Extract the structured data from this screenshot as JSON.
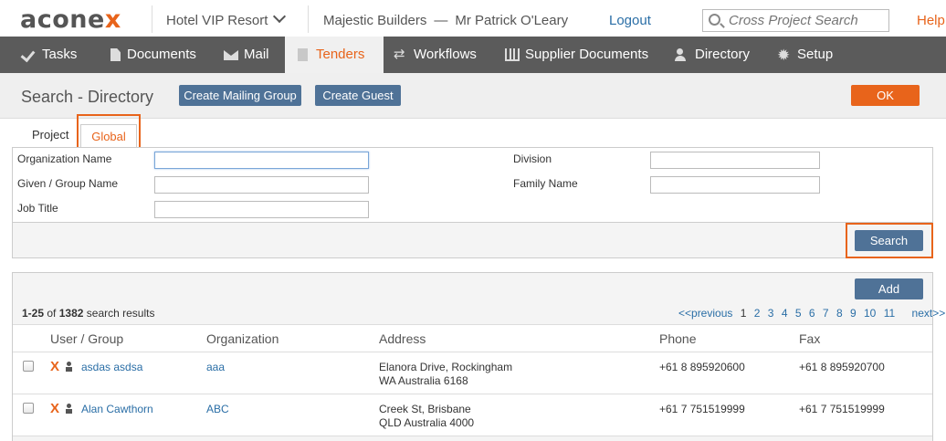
{
  "header": {
    "logo_prefix": "acone",
    "logo_suffix": "x",
    "project": "Hotel VIP Resort",
    "organization": "Majestic Builders",
    "separator": "—",
    "user": "Mr Patrick O'Leary",
    "logout": "Logout",
    "search_placeholder": "Cross Project Search",
    "help": "Help"
  },
  "nav": {
    "items": [
      {
        "label": "Tasks",
        "icon": "check-icon"
      },
      {
        "label": "Documents",
        "icon": "document-icon"
      },
      {
        "label": "Mail",
        "icon": "mail-icon"
      },
      {
        "label": "Tenders",
        "icon": "tender-icon",
        "active": true
      },
      {
        "label": "Workflows",
        "icon": "workflow-icon"
      },
      {
        "label": "Supplier Documents",
        "icon": "supplier-icon"
      },
      {
        "label": "Directory",
        "icon": "people-icon"
      },
      {
        "label": "Setup",
        "icon": "gear-icon"
      }
    ]
  },
  "page": {
    "title": "Search - Directory",
    "create_mailing_group": "Create Mailing Group",
    "create_guest": "Create Guest",
    "ok": "OK"
  },
  "tabs": {
    "project": "Project",
    "global": "Global"
  },
  "form": {
    "org_name_label": "Organization Name",
    "given_name_label": "Given / Group Name",
    "job_title_label": "Job Title",
    "division_label": "Division",
    "family_name_label": "Family Name",
    "org_name_value": "",
    "given_name_value": "",
    "job_title_value": "",
    "division_value": "",
    "family_name_value": "",
    "search_button": "Search"
  },
  "results": {
    "add_button": "Add",
    "range": "1-25",
    "of": "of",
    "total": "1382",
    "suffix": "search results",
    "pager": {
      "previous": "<<previous",
      "pages": [
        "1",
        "2",
        "3",
        "4",
        "5",
        "6",
        "7",
        "8",
        "9",
        "10",
        "11"
      ],
      "current": "1",
      "next": "next>>"
    },
    "columns": {
      "user": "User / Group",
      "organization": "Organization",
      "address": "Address",
      "phone": "Phone",
      "fax": "Fax"
    },
    "rows": [
      {
        "user": "asdas asdsa",
        "organization": "aaa",
        "address_line1": "Elanora Drive, Rockingham",
        "address_line2": "WA Australia 6168",
        "phone": "+61 8 895920600",
        "fax": "+61 8 895920700"
      },
      {
        "user": "Alan Cawthorn",
        "organization": "ABC",
        "address_line1": "Creek St, Brisbane",
        "address_line2": "QLD Australia 4000",
        "phone": "+61 7 751519999",
        "fax": "+61 7 751519999"
      }
    ]
  },
  "colors": {
    "accent": "#e8641b",
    "nav_bg": "#5b5b5b",
    "button_blue": "#4f7297",
    "link": "#2a6ea6"
  }
}
